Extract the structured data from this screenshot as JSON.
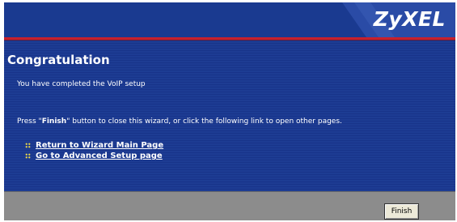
{
  "header": {
    "logo_text": "ZyXEL"
  },
  "content": {
    "title": "Congratulation",
    "message": "You have completed the VoIP setup",
    "instruction_prefix": "Press \"",
    "instruction_bold": "Finish",
    "instruction_suffix": "\" button to close this wizard, or click the following link to open other pages."
  },
  "links": [
    {
      "label": "Return to Wizard Main Page"
    },
    {
      "label": "Go to Advanced Setup page"
    }
  ],
  "footer": {
    "finish_label": "Finish"
  },
  "colors": {
    "background": "#1c3a8f",
    "accent_red": "#c7202c",
    "footer_gray": "#8c8c8c",
    "bullet_yellow": "#e6d44a"
  },
  "icons": {
    "link_bullet": "dotted-bullet-icon"
  }
}
